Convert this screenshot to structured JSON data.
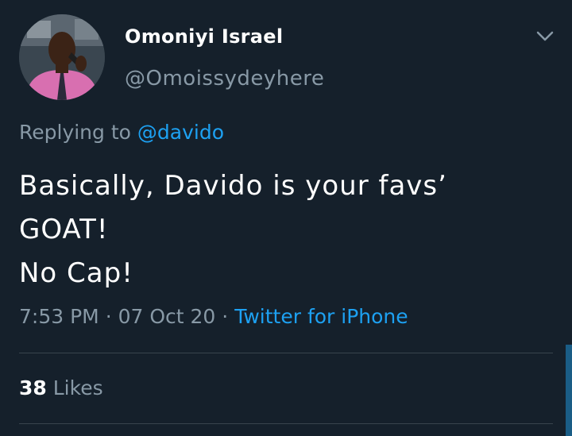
{
  "author": {
    "display_name": "Omoniyi Israel",
    "handle": "@Omoissydeyhere"
  },
  "reply": {
    "prefix": "Replying to",
    "mention": "@davido"
  },
  "tweet": {
    "lines": [
      "Basically, Davido is your favs’",
      "GOAT!",
      "No Cap!"
    ]
  },
  "meta": {
    "time": "7:53 PM",
    "date": "07 Oct 20",
    "source": "Twitter for iPhone",
    "separator": "·"
  },
  "engagement": {
    "likes_count": "38",
    "likes_label": "Likes"
  },
  "icons": {
    "menu": "chevron-down-icon"
  },
  "colors": {
    "background": "#15202b",
    "text": "#ffffff",
    "secondary": "#8899a6",
    "accent": "#1da1f2",
    "divider": "#38444d"
  }
}
